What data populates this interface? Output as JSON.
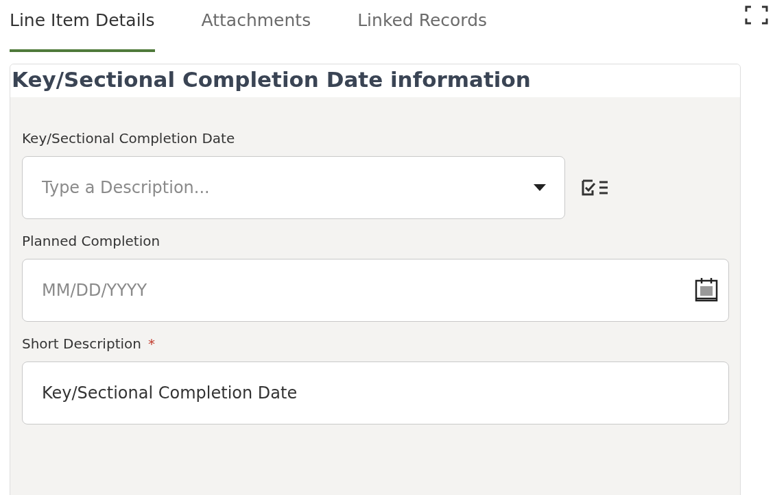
{
  "tabs": [
    {
      "label": "Line Item Details",
      "selected": true
    },
    {
      "label": "Attachments",
      "selected": false
    },
    {
      "label": "Linked Records",
      "selected": false
    }
  ],
  "section": {
    "title": "Key/Sectional Completion Date information",
    "fields": [
      {
        "kind": "select",
        "label": "Key/Sectional Completion Date",
        "placeholder": "Type a Description..."
      },
      {
        "kind": "date",
        "label": "Planned Completion",
        "placeholder": "MM/DD/YYYY"
      },
      {
        "kind": "text",
        "label": "Short Description",
        "required_mark": "*",
        "value": "Key/Sectional Completion Date"
      }
    ]
  }
}
